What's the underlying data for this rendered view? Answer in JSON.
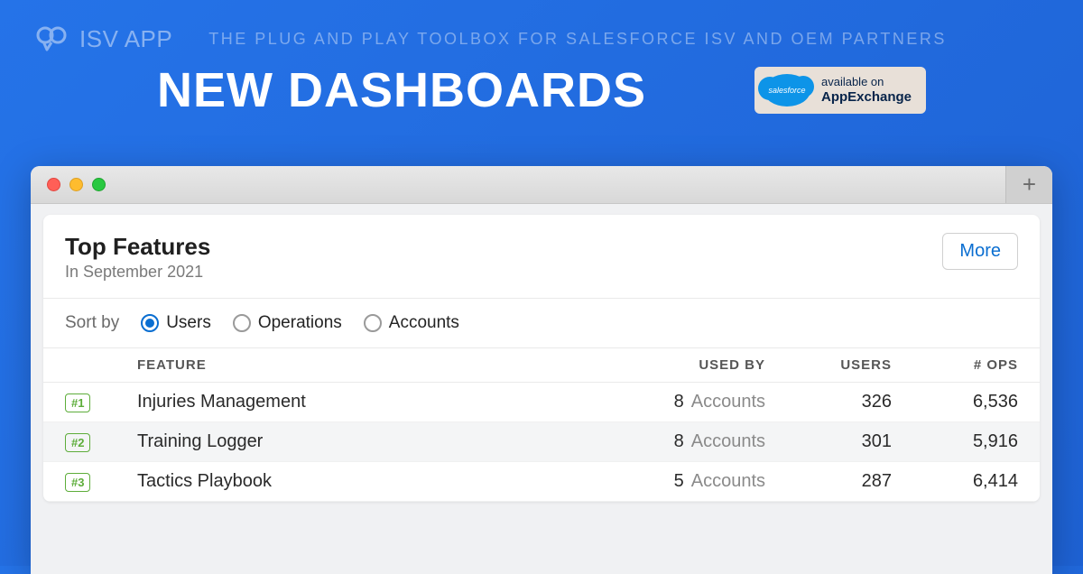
{
  "brand": {
    "logo_text": "ISV APP",
    "tagline": "THE PLUG AND PLAY TOOLBOX FOR SALESFORCE ISV AND OEM PARTNERS"
  },
  "hero": {
    "title": "NEW DASHBOARDS",
    "badge": {
      "cloud_text": "salesforce",
      "line1": "available on",
      "line2": "AppExchange"
    }
  },
  "window": {
    "plus": "+"
  },
  "card": {
    "title": "Top Features",
    "subtitle": "In September 2021",
    "more_label": "More"
  },
  "sort": {
    "label": "Sort by",
    "options": [
      "Users",
      "Operations",
      "Accounts"
    ],
    "selected": "Users"
  },
  "table": {
    "columns": {
      "feature": "FEATURE",
      "used_by": "USED BY",
      "users": "USERS",
      "ops": "# OPS"
    },
    "rows": [
      {
        "rank": "#1",
        "feature": "Injuries Management",
        "used_by_count": "8",
        "used_by_unit": "Accounts",
        "users": "326",
        "ops": "6,536"
      },
      {
        "rank": "#2",
        "feature": "Training Logger",
        "used_by_count": "8",
        "used_by_unit": "Accounts",
        "users": "301",
        "ops": "5,916"
      },
      {
        "rank": "#3",
        "feature": "Tactics Playbook",
        "used_by_count": "5",
        "used_by_unit": "Accounts",
        "users": "287",
        "ops": "6,414"
      }
    ]
  }
}
